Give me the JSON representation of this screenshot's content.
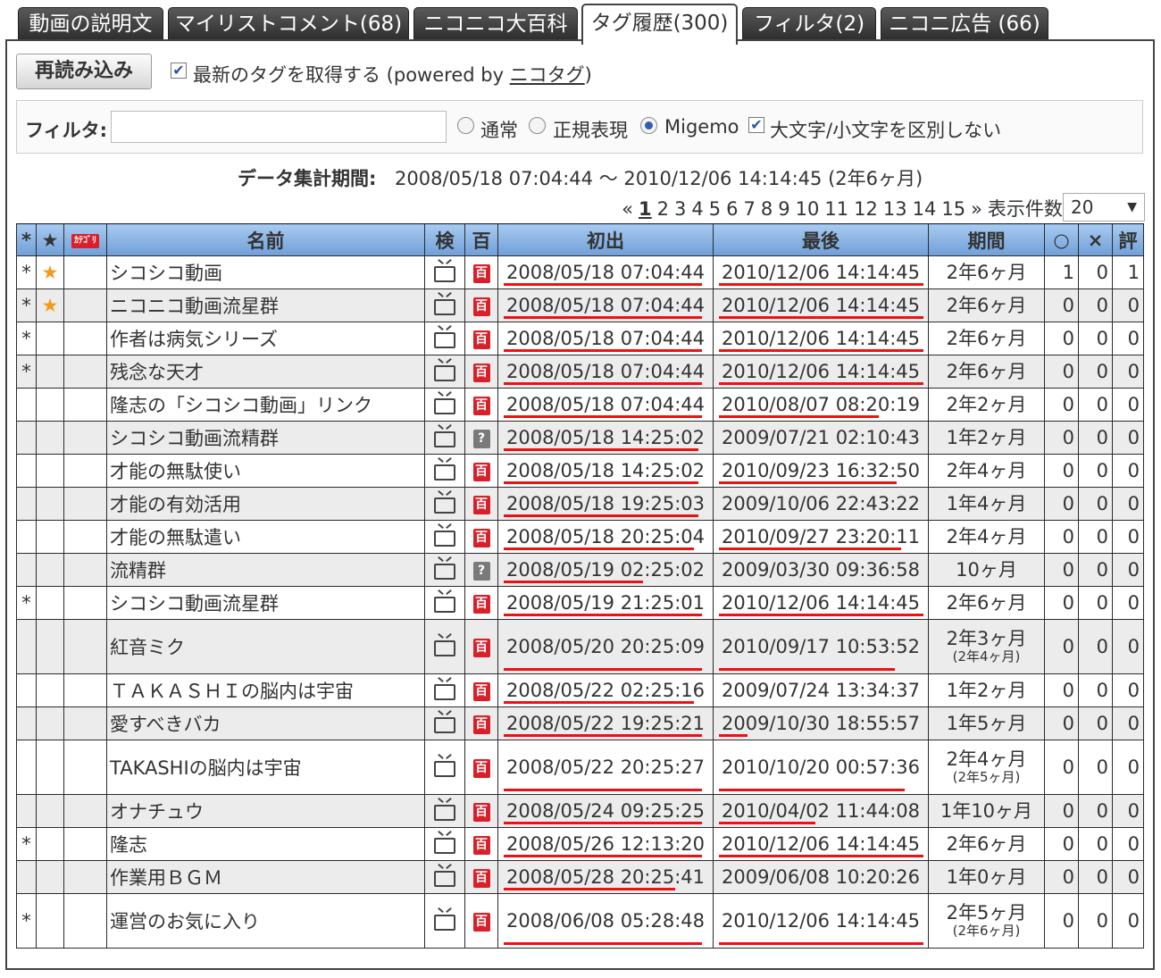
{
  "tabs": [
    {
      "label": "動画の説明文",
      "active": false
    },
    {
      "label": "マイリストコメント(68)",
      "active": false
    },
    {
      "label": "ニコニコ大百科",
      "active": false
    },
    {
      "label": "タグ履歴(300)",
      "active": true
    },
    {
      "label": "フィルタ(2)",
      "active": false
    },
    {
      "label": "ニコニ広告 (66)",
      "active": false
    }
  ],
  "toolbar": {
    "reload_label": "再読み込み",
    "fetch_latest_checked": true,
    "fetch_latest_label": "最新のタグを取得する (powered by ",
    "nicotag_link": "ニコタグ",
    "fetch_latest_suffix": ")"
  },
  "filter": {
    "label": "フィルタ:",
    "value": "",
    "modes": [
      {
        "label": "通常",
        "checked": false
      },
      {
        "label": "正規表現",
        "checked": false
      },
      {
        "label": "Migemo",
        "checked": true
      }
    ],
    "ignore_case_checked": true,
    "ignore_case_label": "大文字/小文字を区別しない"
  },
  "period": {
    "label": "データ集計期間:",
    "value": "2008/05/18 07:04:44 ～ 2010/12/06 14:14:45 (2年6ヶ月)"
  },
  "pager": {
    "prev": "«",
    "pages": [
      "1",
      "2",
      "3",
      "4",
      "5",
      "6",
      "7",
      "8",
      "9",
      "10",
      "11",
      "12",
      "13",
      "14",
      "15"
    ],
    "current": "1",
    "next": "»",
    "per_page_label": "表示件数:",
    "per_page_value": "20"
  },
  "table": {
    "headers": {
      "lock": "*",
      "fav": "★",
      "category": "ｶﾃｺﾞﾘ",
      "name": "名前",
      "search": "検",
      "dic": "百",
      "first": "初出",
      "last": "最後",
      "period": "期間",
      "good": "○",
      "bad": "×",
      "score": "評"
    },
    "rows": [
      {
        "lock": "*",
        "fav": "★",
        "name": "シコシコ動画",
        "dic": "active",
        "first": "2008/05/18 07:04:44",
        "last": "2010/12/06 14:14:45",
        "period": "2年6ヶ月",
        "period_sub": "",
        "good": "1",
        "bad": "0",
        "score": "1",
        "first_bar": 0.97,
        "last_bar": 1.0
      },
      {
        "lock": "*",
        "fav": "★",
        "name": "ニコニコ動画流星群",
        "dic": "active",
        "first": "2008/05/18 07:04:44",
        "last": "2010/12/06 14:14:45",
        "period": "2年6ヶ月",
        "period_sub": "",
        "good": "0",
        "bad": "0",
        "score": "0",
        "first_bar": 0.97,
        "last_bar": 1.0
      },
      {
        "lock": "*",
        "fav": "",
        "name": "作者は病気シリーズ",
        "dic": "active",
        "first": "2008/05/18 07:04:44",
        "last": "2010/12/06 14:14:45",
        "period": "2年6ヶ月",
        "period_sub": "",
        "good": "0",
        "bad": "0",
        "score": "0",
        "first_bar": 0.97,
        "last_bar": 1.0
      },
      {
        "lock": "*",
        "fav": "",
        "name": "残念な天才",
        "dic": "active",
        "first": "2008/05/18 07:04:44",
        "last": "2010/12/06 14:14:45",
        "period": "2年6ヶ月",
        "period_sub": "",
        "good": "0",
        "bad": "0",
        "score": "0",
        "first_bar": 0.97,
        "last_bar": 1.0
      },
      {
        "lock": "",
        "fav": "",
        "name": "隆志の「シコシコ動画」リンク",
        "dic": "active",
        "first": "2008/05/18 07:04:44",
        "last": "2010/08/07 08:20:19",
        "period": "2年2ヶ月",
        "period_sub": "",
        "good": "0",
        "bad": "0",
        "score": "0",
        "first_bar": 0.97,
        "last_bar": 0.78
      },
      {
        "lock": "",
        "fav": "",
        "name": "シコシコ動画流精群",
        "dic": "unknown",
        "first": "2008/05/18 14:25:02",
        "last": "2009/07/21 02:10:43",
        "period": "1年2ヶ月",
        "period_sub": "",
        "good": "0",
        "bad": "0",
        "score": "0",
        "first_bar": 0.95,
        "last_bar": 0.0
      },
      {
        "lock": "",
        "fav": "",
        "name": "才能の無駄使い",
        "dic": "active",
        "first": "2008/05/18 14:25:02",
        "last": "2010/09/23 16:32:50",
        "period": "2年4ヶ月",
        "period_sub": "",
        "good": "0",
        "bad": "0",
        "score": "0",
        "first_bar": 0.95,
        "last_bar": 0.87
      },
      {
        "lock": "",
        "fav": "",
        "name": "才能の有効活用",
        "dic": "active",
        "first": "2008/05/18 19:25:03",
        "last": "2009/10/06 22:43:22",
        "period": "1年4ヶ月",
        "period_sub": "",
        "good": "0",
        "bad": "0",
        "score": "0",
        "first_bar": 0.95,
        "last_bar": 0.0
      },
      {
        "lock": "",
        "fav": "",
        "name": "才能の無駄遣い",
        "dic": "active",
        "first": "2008/05/18 20:25:04",
        "last": "2010/09/27 23:20:11",
        "period": "2年4ヶ月",
        "period_sub": "",
        "good": "0",
        "bad": "0",
        "score": "0",
        "first_bar": 0.93,
        "last_bar": 0.89
      },
      {
        "lock": "",
        "fav": "",
        "name": "流精群",
        "dic": "unknown",
        "first": "2008/05/19 02:25:02",
        "last": "2009/03/30 09:36:58",
        "period": "10ヶ月",
        "period_sub": "",
        "good": "0",
        "bad": "0",
        "score": "0",
        "first_bar": 0.68,
        "last_bar": 0.0
      },
      {
        "lock": "*",
        "fav": "",
        "name": "シコシコ動画流星群",
        "dic": "active",
        "first": "2008/05/19 21:25:01",
        "last": "2010/12/06 14:14:45",
        "period": "2年6ヶ月",
        "period_sub": "",
        "good": "0",
        "bad": "0",
        "score": "0",
        "first_bar": 0.97,
        "last_bar": 1.0
      },
      {
        "lock": "",
        "fav": "",
        "name": "紅音ミク",
        "dic": "active",
        "first": "2008/05/20 20:25:09",
        "last": "2010/09/17 10:53:52",
        "period": "2年3ヶ月",
        "period_sub": "(2年4ヶ月)",
        "good": "0",
        "bad": "0",
        "score": "0",
        "first_bar": 0.97,
        "last_bar": 0.86
      },
      {
        "lock": "",
        "fav": "",
        "name": "ＴＡＫＡＳＨＩの脳内は宇宙",
        "dic": "active",
        "first": "2008/05/22 02:25:16",
        "last": "2009/07/24 13:34:37",
        "period": "1年2ヶ月",
        "period_sub": "",
        "good": "0",
        "bad": "0",
        "score": "0",
        "first_bar": 0.93,
        "last_bar": 0.0
      },
      {
        "lock": "",
        "fav": "",
        "name": "愛すべきバカ",
        "dic": "active",
        "first": "2008/05/22 19:25:21",
        "last": "2009/10/30 18:55:57",
        "period": "1年5ヶ月",
        "period_sub": "",
        "good": "0",
        "bad": "0",
        "score": "0",
        "first_bar": 0.97,
        "last_bar": 0.14
      },
      {
        "lock": "",
        "fav": "",
        "name": "TAKASHIの脳内は宇宙",
        "dic": "active",
        "first": "2008/05/22 20:25:27",
        "last": "2010/10/20 00:57:36",
        "period": "2年4ヶ月",
        "period_sub": "(2年5ヶ月)",
        "good": "0",
        "bad": "0",
        "score": "0",
        "first_bar": 0.97,
        "last_bar": 0.91
      },
      {
        "lock": "",
        "fav": "",
        "name": "オナチュウ",
        "dic": "active",
        "first": "2008/05/24 09:25:25",
        "last": "2010/04/02 11:44:08",
        "period": "1年10ヶ月",
        "period_sub": "",
        "good": "0",
        "bad": "0",
        "score": "0",
        "first_bar": 0.97,
        "last_bar": 0.47
      },
      {
        "lock": "*",
        "fav": "",
        "name": "隆志",
        "dic": "active",
        "first": "2008/05/26 12:13:20",
        "last": "2010/12/06 14:14:45",
        "period": "2年6ヶ月",
        "period_sub": "",
        "good": "0",
        "bad": "0",
        "score": "0",
        "first_bar": 0.97,
        "last_bar": 1.0
      },
      {
        "lock": "",
        "fav": "",
        "name": "作業用ＢＧＭ",
        "dic": "active",
        "first": "2008/05/28 20:25:41",
        "last": "2009/06/08 10:20:26",
        "period": "1年0ヶ月",
        "period_sub": "",
        "good": "0",
        "bad": "0",
        "score": "0",
        "first_bar": 0.84,
        "last_bar": 0.0
      },
      {
        "lock": "*",
        "fav": "",
        "name": "運営のお気に入り",
        "dic": "active",
        "first": "2008/06/08 05:28:48",
        "last": "2010/12/06 14:14:45",
        "period": "2年5ヶ月",
        "period_sub": "(2年6ヶ月)",
        "good": "0",
        "bad": "0",
        "score": "0",
        "first_bar": 0.97,
        "last_bar": 1.0
      }
    ]
  },
  "colors": {
    "header_bg": "#8fb8e8",
    "timeline_bar": "#ee1111",
    "star": "#f39a1c",
    "dic_icon": "#d8202a"
  }
}
